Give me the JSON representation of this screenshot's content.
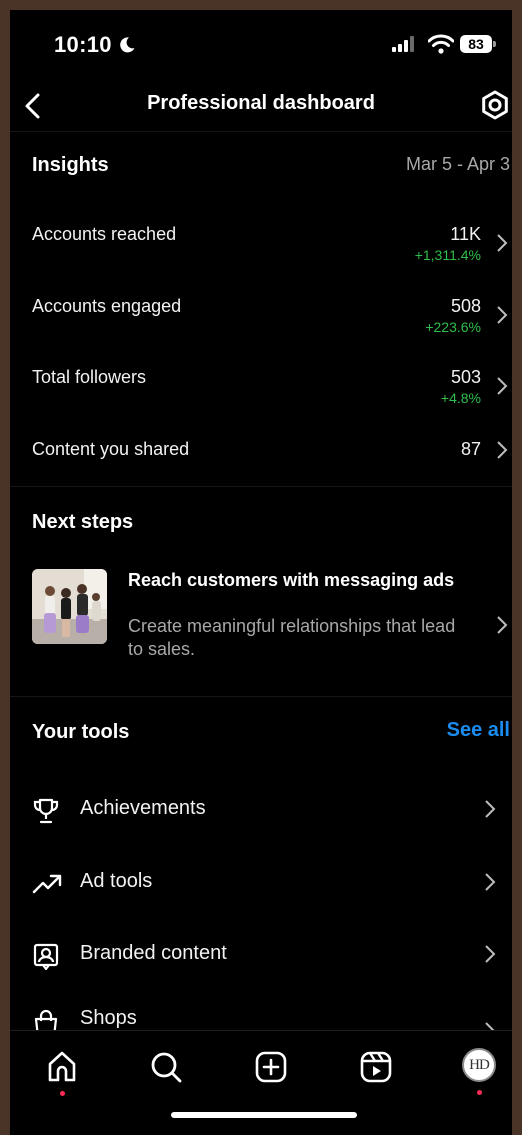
{
  "status": {
    "time": "10:10",
    "battery": "83"
  },
  "header": {
    "title": "Professional dashboard"
  },
  "insights": {
    "title": "Insights",
    "date_range": "Mar 5 - Apr 3",
    "rows": [
      {
        "label": "Accounts reached",
        "value": "11K",
        "change": "+1,311.4%"
      },
      {
        "label": "Accounts engaged",
        "value": "508",
        "change": "+223.6%"
      },
      {
        "label": "Total followers",
        "value": "503",
        "change": "+4.8%"
      },
      {
        "label": "Content you shared",
        "value": "87",
        "change": ""
      }
    ]
  },
  "next_steps": {
    "title": "Next steps",
    "card": {
      "title": "Reach customers with messaging ads",
      "description": "Create meaningful relationships that lead to sales."
    }
  },
  "tools": {
    "title": "Your tools",
    "see_all": "See all",
    "items": [
      {
        "label": "Achievements",
        "icon": "trophy-icon"
      },
      {
        "label": "Ad tools",
        "icon": "trending-up-icon"
      },
      {
        "label": "Branded content",
        "icon": "branded-content-icon"
      },
      {
        "label": "Shops",
        "icon": "shopping-bag-icon"
      }
    ]
  },
  "tabbar": {
    "avatar_initials": "HD",
    "items": [
      "home-icon",
      "search-icon",
      "create-icon",
      "reels-icon",
      "profile-avatar"
    ]
  },
  "colors": {
    "background": "#000000",
    "positive": "#2fbf4a",
    "link": "#1a8cf0",
    "muted": "#a8a8a8",
    "notification_dot": "#ff2d55"
  }
}
